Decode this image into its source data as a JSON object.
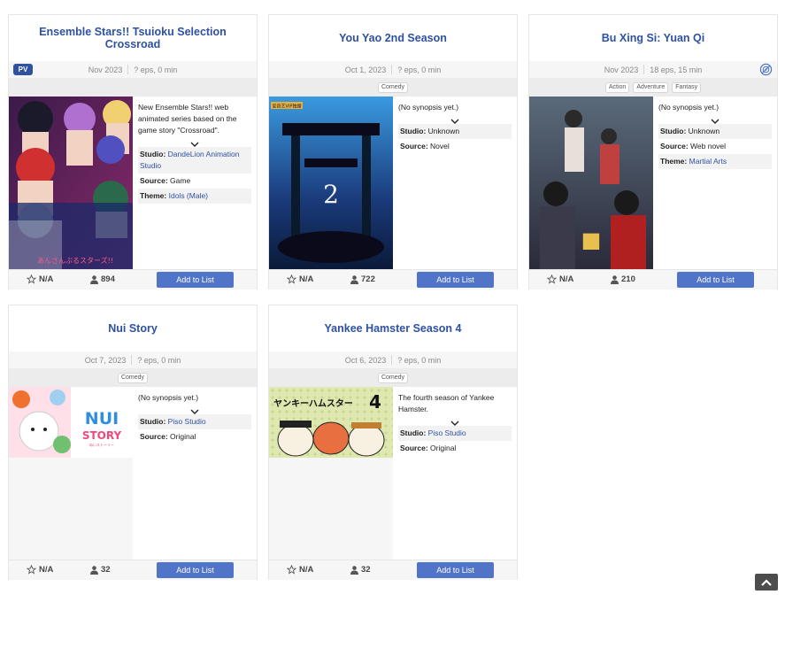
{
  "cards": [
    {
      "title": "Ensemble Stars!! Tsuioku Selection Crossroad",
      "pv": "PV",
      "date": "Nov 2023",
      "eps": "? eps, 0 min",
      "genres": [],
      "synopsis": "New Ensemble Stars!! web animated series based on the game story \"Crossroad\".",
      "studio_label": "Studio:",
      "studio": "DandeLion Animation Studio",
      "source_label": "Source:",
      "source": "Game",
      "theme_label": "Theme:",
      "theme": "Idols (Male)",
      "score": "N/A",
      "members": "894",
      "add": "Add to List"
    },
    {
      "title": "You Yao 2nd Season",
      "date": "Oct 1, 2023",
      "eps": "? eps, 0 min",
      "genres": [
        "Comedy"
      ],
      "synopsis": "(No synopsis yet.)",
      "studio_label": "Studio:",
      "studio": "Unknown",
      "source_label": "Source:",
      "source": "Novel",
      "score": "N/A",
      "members": "722",
      "add": "Add to List"
    },
    {
      "title": "Bu Xing Si: Yuan Qi",
      "date": "Nov 2023",
      "eps": "18 eps, 15 min",
      "genres": [
        "Action",
        "Adventure",
        "Fantasy"
      ],
      "synopsis": "(No synopsis yet.)",
      "studio_label": "Studio:",
      "studio": "Unknown",
      "source_label": "Source:",
      "source": "Web novel",
      "theme_label": "Theme:",
      "theme": "Martial Arts",
      "score": "N/A",
      "members": "210",
      "add": "Add to List"
    },
    {
      "title": "Nui Story",
      "date": "Oct 7, 2023",
      "eps": "? eps, 0 min",
      "genres": [
        "Comedy"
      ],
      "synopsis": "(No synopsis yet.)",
      "studio_label": "Studio:",
      "studio": "Piso Studio",
      "source_label": "Source:",
      "source": "Original",
      "score": "N/A",
      "members": "32",
      "add": "Add to List"
    },
    {
      "title": "Yankee Hamster Season 4",
      "date": "Oct 6, 2023",
      "eps": "? eps, 0 min",
      "genres": [
        "Comedy"
      ],
      "synopsis": "The fourth season of Yankee Hamster.",
      "studio_label": "Studio:",
      "studio": "Piso Studio",
      "source_label": "Source:",
      "source": "Original",
      "score": "N/A",
      "members": "32",
      "add": "Add to List"
    }
  ],
  "posters": {
    "ensemble_caption": "あんさんぶるスターズ!!",
    "youyao_badge": "爱奇艺VIP独播",
    "nui_logo_top": "NUI",
    "nui_logo_bottom": "STORY",
    "nui_sub": "ぬいストーリー",
    "yankee_title": "ヤンキーハムスター",
    "yankee_num": "4"
  },
  "icons": [
    "star-icon",
    "user-icon",
    "chevron-down-icon",
    "streaming-icon",
    "back-to-top-icon"
  ],
  "colors": {
    "accent": "#2e51a2",
    "button": "#4f74c8"
  }
}
